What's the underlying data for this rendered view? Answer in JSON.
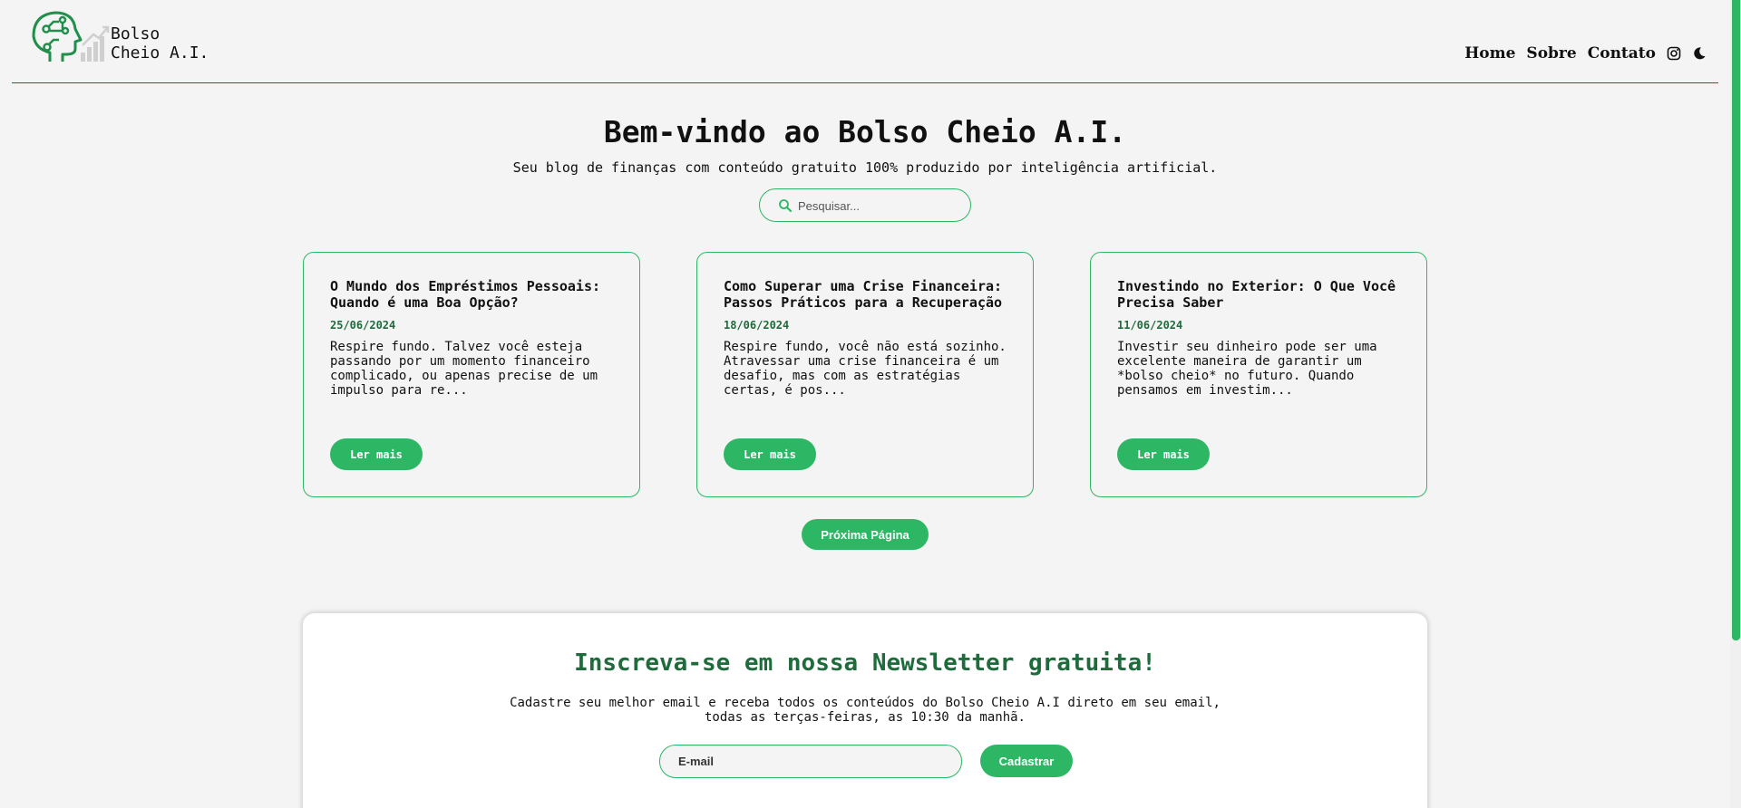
{
  "header": {
    "brand": "Bolso\nCheio A.I.",
    "nav": {
      "home": "Home",
      "about": "Sobre",
      "contact": "Contato"
    },
    "icons": [
      "brain-circuit-logo-icon",
      "instagram-icon",
      "moon-icon"
    ]
  },
  "hero": {
    "title": "Bem-vindo ao Bolso Cheio A.I.",
    "subtitle": "Seu blog de finanças com conteúdo gratuito 100% produzido por inteligência artificial.",
    "search_placeholder": "Pesquisar..."
  },
  "posts": [
    {
      "title": "O Mundo dos Empréstimos Pessoais: Quando é uma Boa Opção?",
      "date": "25/06/2024",
      "excerpt": "Respire fundo. Talvez você esteja passando por um momento financeiro complicado, ou apenas precise de um impulso para re...",
      "button": "Ler mais"
    },
    {
      "title": "Como Superar uma Crise Financeira: Passos Práticos para a Recuperação",
      "date": "18/06/2024",
      "excerpt": "Respire fundo, você não está sozinho. Atravessar uma crise financeira é um desafio, mas com as estratégias certas, é pos...",
      "button": "Ler mais"
    },
    {
      "title": "Investindo no Exterior: O Que Você Precisa Saber",
      "date": "11/06/2024",
      "excerpt": "Investir seu dinheiro pode ser uma excelente maneira de garantir um *bolso cheio* no futuro. Quando pensamos em investim...",
      "button": "Ler mais"
    }
  ],
  "pagination": {
    "next_label": "Próxima Página"
  },
  "newsletter": {
    "title": "Inscreva-se em nossa Newsletter gratuita!",
    "description": "Cadastre seu melhor email e receba todos os conteúdos do Bolso Cheio A.I direto em seu email, todas as terças-feiras, as 10:30 da manhã.",
    "email_placeholder": "E-mail",
    "submit_label": "Cadastrar"
  },
  "colors": {
    "accent": "#2db765",
    "dark_green": "#1e6b3c",
    "background": "#f4f4f4"
  }
}
